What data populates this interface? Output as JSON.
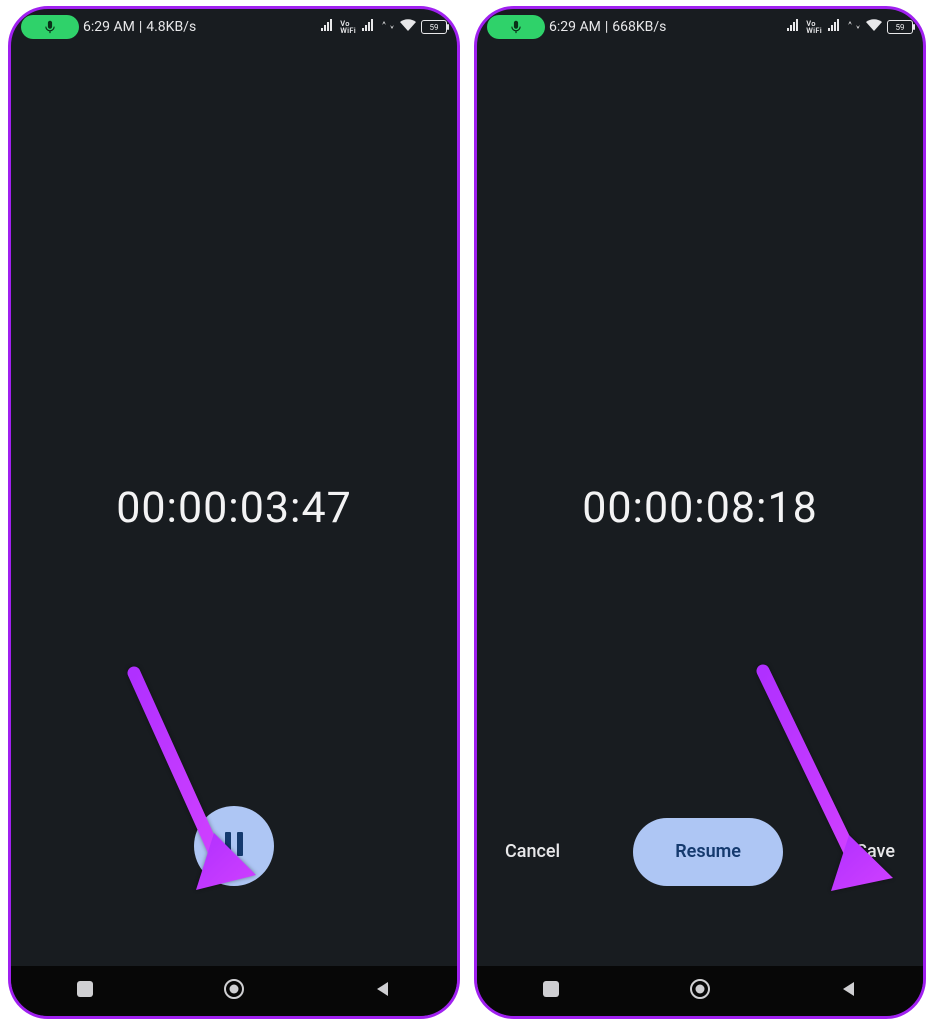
{
  "screens": [
    {
      "status": {
        "time": "6:29 AM",
        "net_speed": "4.8KB/s",
        "battery_label": "59"
      },
      "timer": "00:00:03:47",
      "controls": {
        "mode": "recording"
      }
    },
    {
      "status": {
        "time": "6:29 AM",
        "net_speed": "668KB/s",
        "battery_label": "59"
      },
      "timer": "00:00:08:18",
      "controls": {
        "mode": "paused",
        "cancel_label": "Cancel",
        "resume_label": "Resume",
        "save_label": "Save"
      }
    }
  ]
}
